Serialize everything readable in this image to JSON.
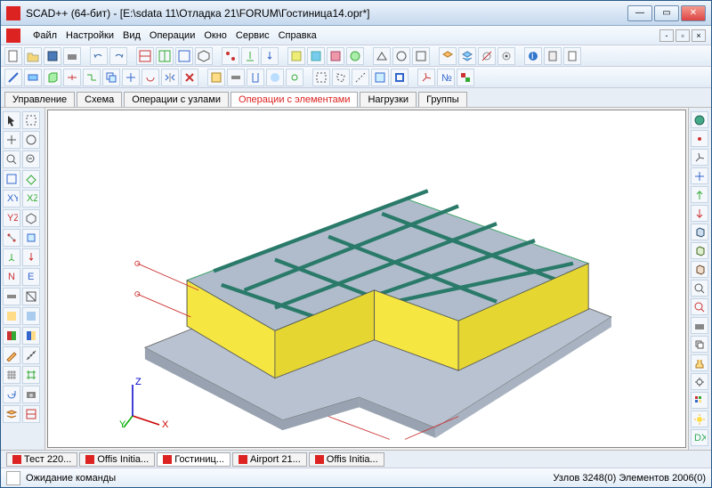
{
  "title": "SCAD++ (64-бит) - [E:\\sdata 11\\Отладка 21\\FORUM\\Гостиница14.opr*]",
  "menu": [
    "Файл",
    "Настройки",
    "Вид",
    "Операции",
    "Окно",
    "Сервис",
    "Справка"
  ],
  "tabs": {
    "items": [
      "Управление",
      "Схема",
      "Операции с узлами",
      "Операции с элементами",
      "Нагрузки",
      "Группы"
    ],
    "active": 3
  },
  "doctabs": [
    "Тест 220...",
    "Offis Initia...",
    "Гостиниц...",
    "Airport 21...",
    "Offis Initia..."
  ],
  "doctabs_active": 2,
  "status": {
    "msg": "Ожидание команды",
    "right": "Узлов 3248(0) Элементов 2006(0)"
  },
  "axes": [
    "X",
    "Y",
    "Z"
  ]
}
